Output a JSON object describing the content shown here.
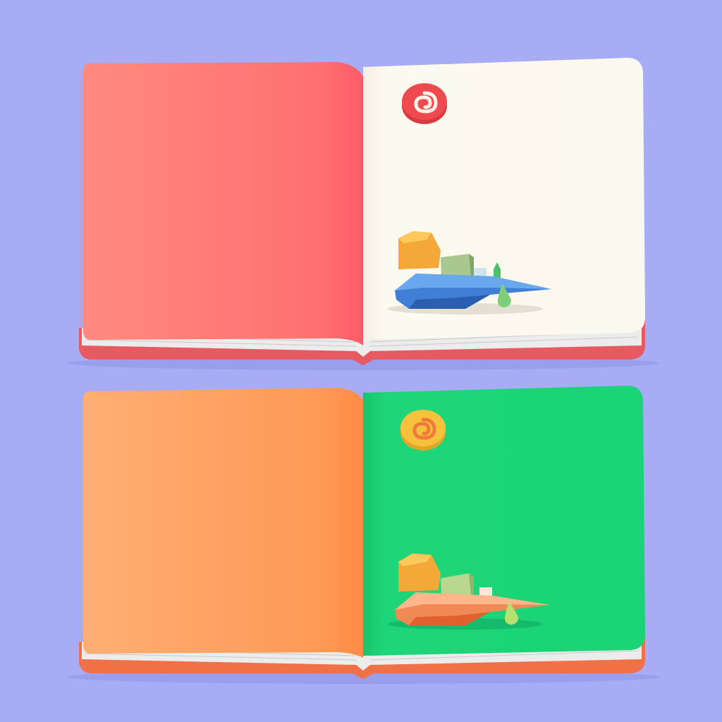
{
  "scene": {
    "background_color": "#a8acf5",
    "notebooks": [
      {
        "id": "top",
        "left_page_color": "#ff7a7a",
        "left_page_highlight": "#ff9a8e",
        "right_page_color": "#fbf8ee",
        "coil_color": "#e8404a",
        "edge_color": "#e85a62",
        "sticker_swirl_color": "#ef4a4f",
        "boat_main_color": "#3f7fd6",
        "boat_accent_color": "#f3a838",
        "boat_detail_color": "#8fbf7a"
      },
      {
        "id": "bottom",
        "left_page_color": "#ffa05a",
        "left_page_highlight": "#ffb27a",
        "right_page_color": "#1fd579",
        "coil_color": "#f0604a",
        "edge_color": "#f07048",
        "sticker_swirl_color": "#f6c23c",
        "boat_main_color": "#f08a55",
        "boat_accent_color": "#f3a838",
        "boat_detail_color": "#b8d890"
      }
    ]
  }
}
